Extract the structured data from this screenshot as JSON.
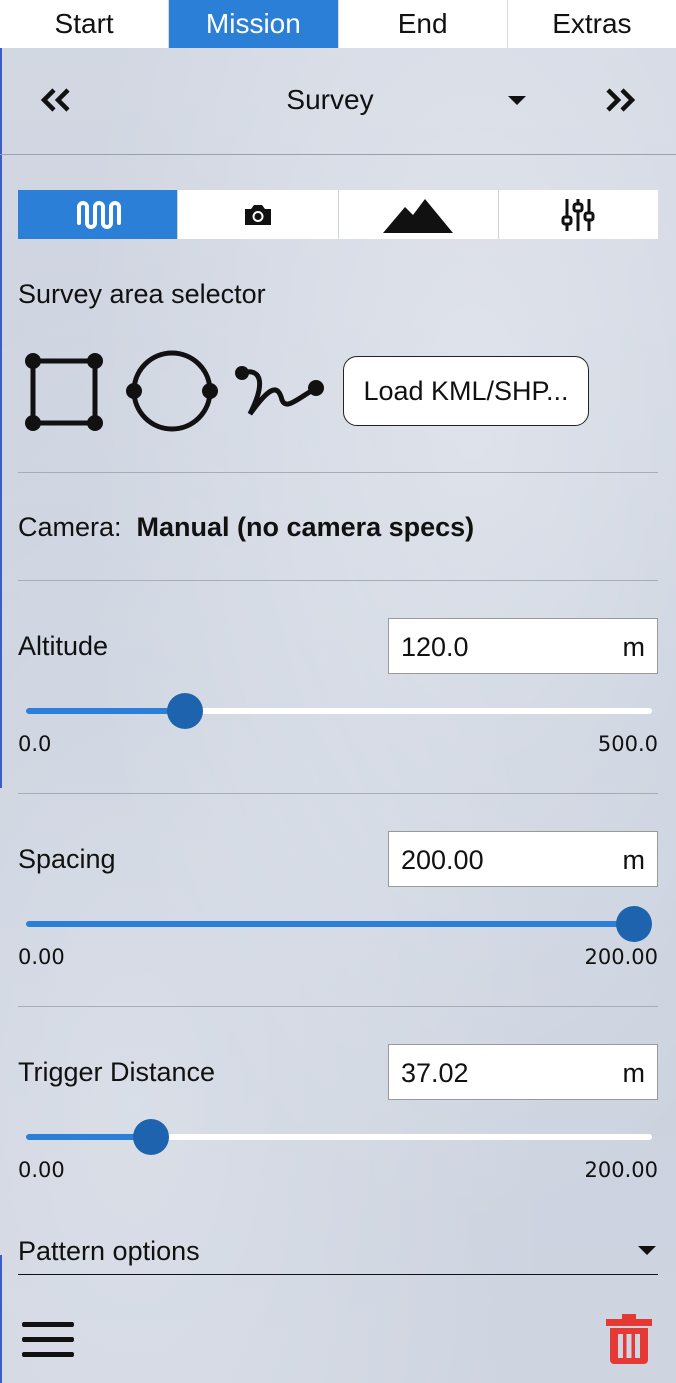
{
  "tabs": [
    {
      "label": "Start",
      "active": false
    },
    {
      "label": "Mission",
      "active": true
    },
    {
      "label": "End",
      "active": false
    },
    {
      "label": "Extras",
      "active": false
    }
  ],
  "pattern": {
    "title": "Survey"
  },
  "icon_tabs": [
    "wave-pattern-icon",
    "camera-icon",
    "terrain-icon",
    "sliders-icon"
  ],
  "area": {
    "heading": "Survey area selector",
    "load_button": "Load KML/SHP..."
  },
  "camera": {
    "label": "Camera:",
    "value": "Manual (no camera specs)"
  },
  "altitude": {
    "label": "Altitude",
    "value": "120.0",
    "unit": "m",
    "min": "0.0",
    "max": "500.0",
    "fraction": 0.254
  },
  "spacing": {
    "label": "Spacing",
    "value": "200.00",
    "unit": "m",
    "min": "0.00",
    "max": "200.00",
    "fraction": 1.0
  },
  "trigger": {
    "label": "Trigger Distance",
    "value": "37.02",
    "unit": "m",
    "min": "0.00",
    "max": "200.00",
    "fraction": 0.2
  },
  "pattern_options": "Pattern options",
  "colors": {
    "accent": "#2b7fd6",
    "thumb": "#1e63ad",
    "danger": "#e53935"
  }
}
